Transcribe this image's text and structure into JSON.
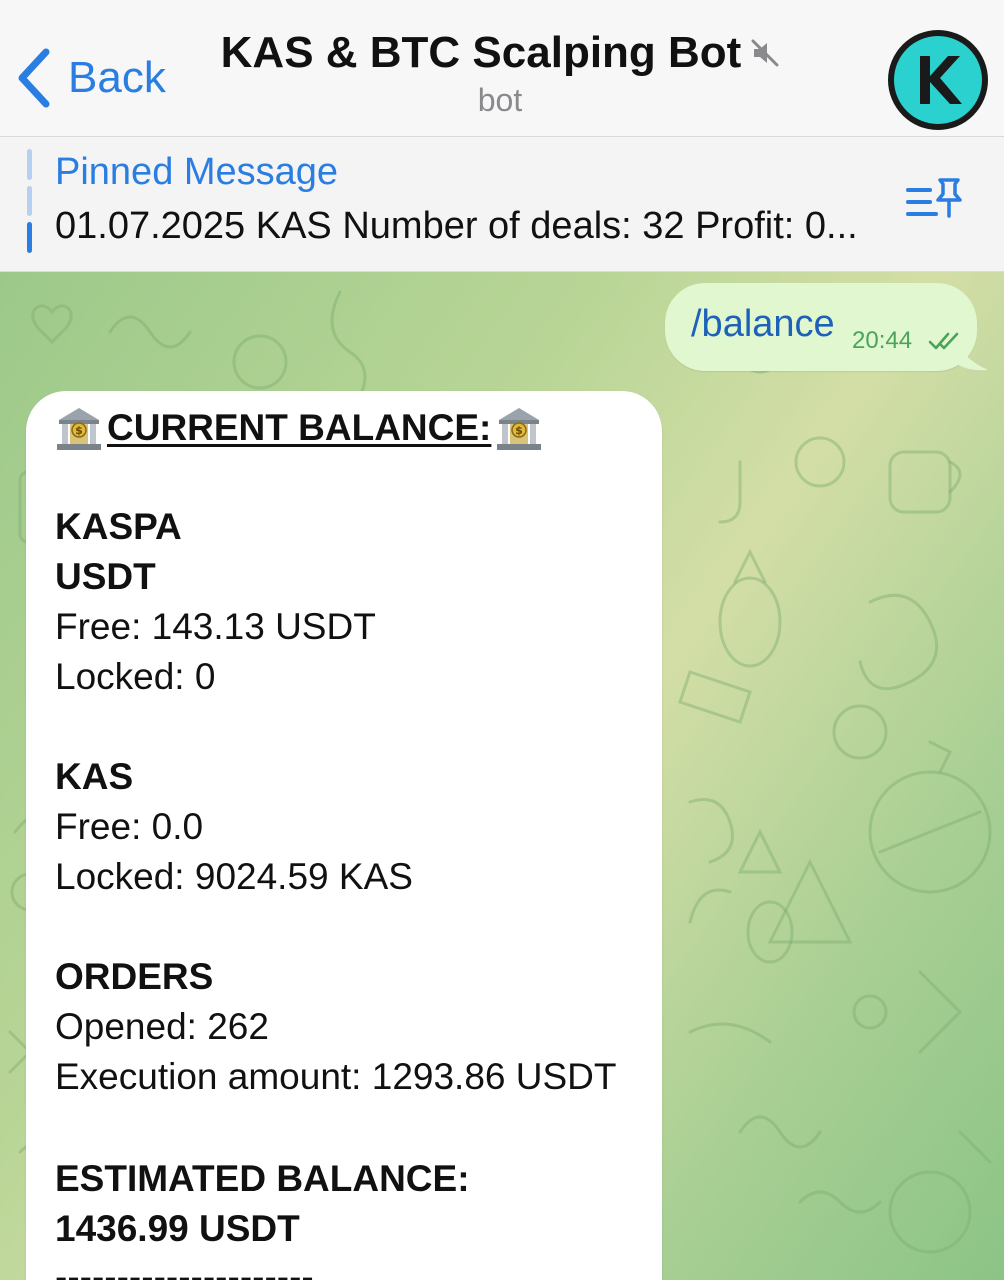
{
  "header": {
    "back_label": "Back",
    "title": "KAS & BTC Scalping Bot",
    "subtitle": "bot"
  },
  "pinned": {
    "label": "Pinned Message",
    "text": "01.07.2025 KAS Number of deals: 32 Profit: 0..."
  },
  "messages": {
    "outgoing": {
      "text": "/balance",
      "time": "20:44"
    },
    "incoming": {
      "heading": "CURRENT BALANCE:",
      "lines": [
        "KASPA",
        "USDT",
        "Free: 143.13 USDT",
        "Locked: 0",
        "KAS",
        "Free: 0.0",
        "Locked: 9024.59 KAS",
        "ORDERS",
        "Opened: 262",
        "Execution amount: 1293.86 USDT",
        "ESTIMATED BALANCE:",
        "1436.99 USDT",
        "---------------------"
      ]
    }
  },
  "colors": {
    "accent": "#2a7de1",
    "outgoing_bubble": "#e1f7cf",
    "avatar_fill": "#1fc7c7"
  },
  "icons": {
    "back": "chevron-left-icon",
    "mute": "muted-speaker-icon",
    "pin_list": "pin-list-icon",
    "read": "double-check-icon",
    "bank": "bank-icon"
  }
}
